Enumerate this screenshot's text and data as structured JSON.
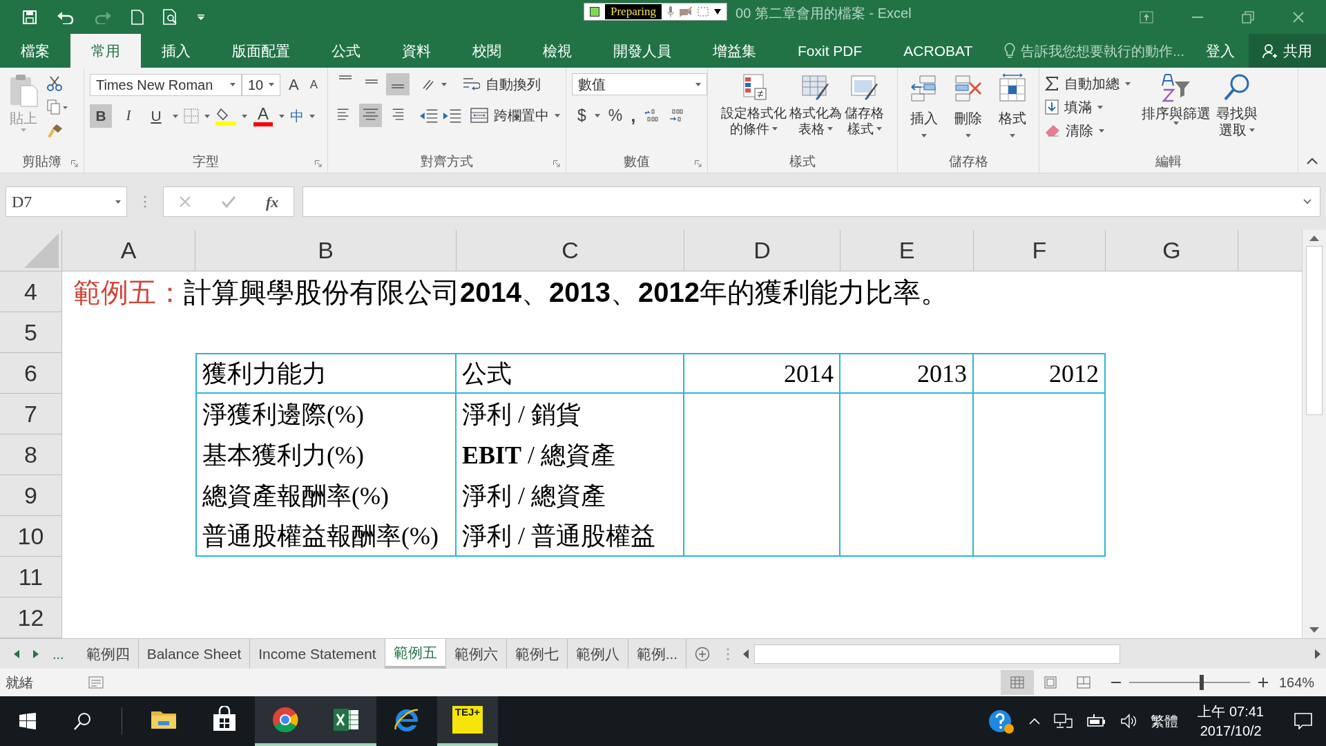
{
  "title_bar": {
    "recorder": "Preparing",
    "title": "00 第二章會用的檔案 - Excel"
  },
  "ribbon_tabs": [
    {
      "label": "檔案",
      "selected": false
    },
    {
      "label": "常用",
      "selected": true
    },
    {
      "label": "插入",
      "selected": false
    },
    {
      "label": "版面配置",
      "selected": false
    },
    {
      "label": "公式",
      "selected": false
    },
    {
      "label": "資料",
      "selected": false
    },
    {
      "label": "校閱",
      "selected": false
    },
    {
      "label": "檢視",
      "selected": false
    },
    {
      "label": "開發人員",
      "selected": false
    },
    {
      "label": "增益集",
      "selected": false
    },
    {
      "label": "Foxit PDF",
      "selected": false
    },
    {
      "label": "ACROBAT",
      "selected": false
    }
  ],
  "tell_me": {
    "placeholder": "告訴我您想要執行的動作..."
  },
  "sign_in": "登入",
  "share": "共用",
  "clipboard": {
    "paste": "貼上",
    "group": "剪貼簿"
  },
  "font": {
    "name": "Times New Roman",
    "size": "10",
    "grow": "A",
    "shrink": "A",
    "font_color": "A",
    "phonetic": "中",
    "group": "字型",
    "styles": [
      {
        "kind": "bold",
        "label": "B",
        "on": true
      },
      {
        "kind": "italic",
        "label": "I",
        "on": false
      },
      {
        "kind": "underline",
        "label": "U",
        "on": false
      }
    ]
  },
  "alignment": {
    "vertical": [
      {
        "kind": "top",
        "on": false
      },
      {
        "kind": "middle",
        "on": false
      },
      {
        "kind": "bottom",
        "on": true
      }
    ],
    "horizontal": [
      {
        "kind": "left",
        "on": false
      },
      {
        "kind": "center",
        "on": true
      },
      {
        "kind": "right",
        "on": false
      }
    ],
    "wrap": "自動換列",
    "merge": "跨欄置中",
    "group": "對齊方式"
  },
  "number": {
    "format": "數值",
    "currency": "$",
    "percent": "%",
    "comma": ",",
    "group": "數值"
  },
  "styles": {
    "buttons": [
      [
        "設定格式化",
        "的條件"
      ],
      [
        "格式化為",
        "表格"
      ],
      [
        "儲存格",
        "樣式"
      ]
    ],
    "group": "樣式"
  },
  "cells": {
    "buttons": [
      "插入",
      "刪除",
      "格式"
    ],
    "group": "儲存格"
  },
  "editing": {
    "autosum": "自動加總",
    "fill": "填滿",
    "clear": "清除",
    "sort": [
      "排序與篩選"
    ],
    "find": [
      "尋找與",
      "選取"
    ],
    "group": "編輯"
  },
  "formula_bar": {
    "name_box": "D7",
    "fx": "fx"
  },
  "columns": [
    "A",
    "B",
    "C",
    "D",
    "E",
    "F",
    "G"
  ],
  "row_numbers": [
    "4",
    "5",
    "6",
    "7",
    "8",
    "9",
    "10",
    "11",
    "12"
  ],
  "heading": {
    "prefix": "範例五：",
    "text": "計算興學股份有限公司**2014**、**2013**、**2012**年的獲利能力比率。"
  },
  "table": {
    "header": [
      "獲利力能力",
      "公式",
      "2014",
      "2013",
      "2012"
    ],
    "rows": [
      [
        "淨獲利邊際(%)",
        "淨利 / 銷貨"
      ],
      [
        "基本獲利力(%)",
        "**EBIT** / 總資產"
      ],
      [
        "總資產報酬率(%)",
        "淨利 / 總資產"
      ],
      [
        "普通股權益報酬率(%)",
        "淨利 / 普通股權益"
      ]
    ]
  },
  "sheet_nav": "...",
  "sheet_tabs": [
    {
      "label": "範例四",
      "selected": false
    },
    {
      "label": "Balance Sheet",
      "selected": false
    },
    {
      "label": "Income Statement",
      "selected": false
    },
    {
      "label": "範例五",
      "selected": true
    },
    {
      "label": "範例六",
      "selected": false
    },
    {
      "label": "範例七",
      "selected": false
    },
    {
      "label": "範例八",
      "selected": false
    },
    {
      "label": "範例...",
      "selected": false
    }
  ],
  "status_bar": {
    "status": "就緒",
    "views": [
      {
        "kind": "normal",
        "selected": true
      },
      {
        "kind": "layout",
        "selected": false
      },
      {
        "kind": "break",
        "selected": false
      }
    ],
    "zoom": {
      "level": 0.6,
      "reading": "164%"
    }
  },
  "taskbar": {
    "apps": [
      {
        "kind": "folder",
        "running": false
      },
      {
        "kind": "store",
        "running": false
      },
      {
        "kind": "chrome",
        "running": true
      },
      {
        "kind": "excel",
        "running": true
      },
      {
        "kind": "ie",
        "running": false
      },
      {
        "kind": "tej",
        "running": true
      }
    ],
    "tej_label": "TEJ+",
    "ime": "繁體",
    "time": "上午 07:41",
    "date": "2017/10/2"
  }
}
